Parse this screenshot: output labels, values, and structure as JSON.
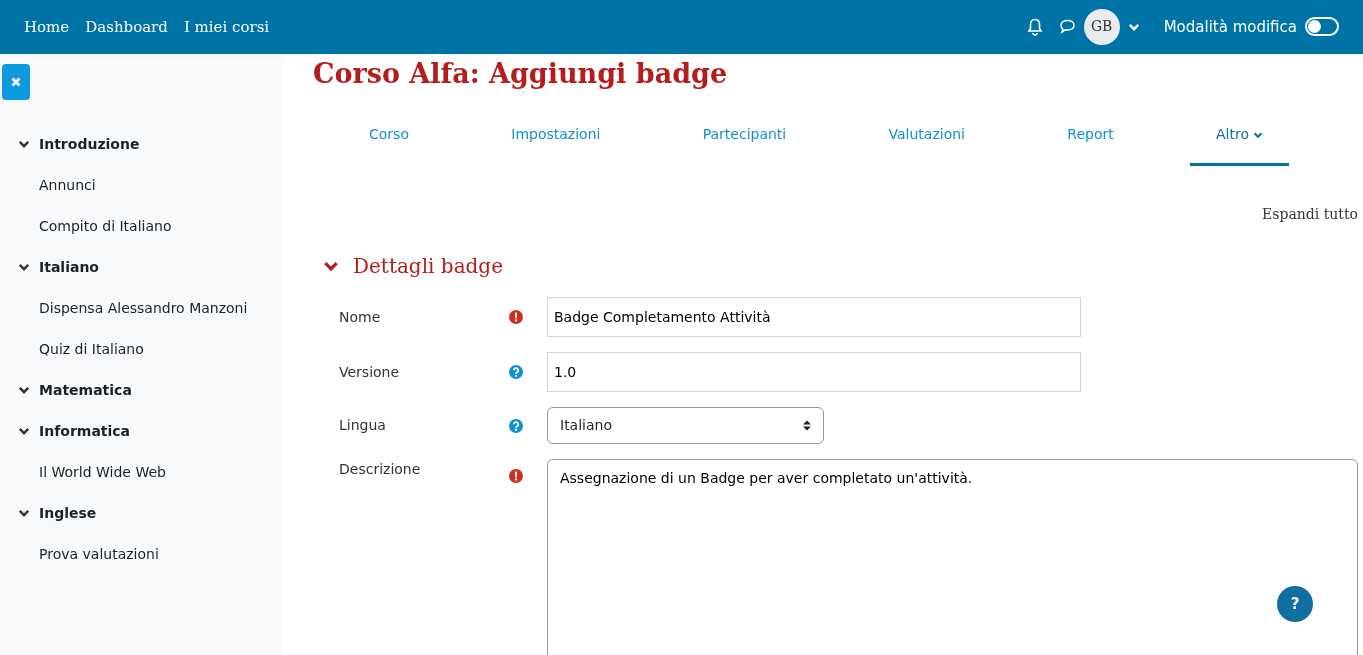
{
  "navbar": {
    "links": [
      "Home",
      "Dashboard",
      "I miei corsi"
    ],
    "avatar": "GB",
    "edit_mode": {
      "label": "Modalità modifica",
      "on": false
    }
  },
  "sidebar": {
    "sections": [
      {
        "title": "Introduzione",
        "expanded": true,
        "children": [
          "Annunci",
          "Compito di Italiano"
        ]
      },
      {
        "title": "Italiano",
        "expanded": true,
        "children": [
          "Dispensa Alessandro Manzoni",
          "Quiz di Italiano"
        ]
      },
      {
        "title": "Matematica",
        "expanded": true
      },
      {
        "title": "Informatica",
        "expanded": true,
        "children": [
          "Il World Wide Web"
        ]
      },
      {
        "title": "Inglese",
        "expanded": true,
        "children": [
          "Prova valutazioni"
        ]
      }
    ]
  },
  "page_title": "Corso Alfa: Aggiungi badge",
  "tabs": [
    {
      "label": "Corso",
      "selected": false,
      "kind": "link"
    },
    {
      "label": "Impostazioni",
      "selected": false,
      "kind": "link"
    },
    {
      "label": "Partecipanti",
      "selected": false,
      "kind": "link"
    },
    {
      "label": "Valutazioni",
      "selected": false,
      "kind": "link"
    },
    {
      "label": "Report",
      "selected": false,
      "kind": "link"
    },
    {
      "label": "Altro",
      "selected": true,
      "kind": "dropdown"
    }
  ],
  "expand_all": "Espandi tutto",
  "section": {
    "title": "Dettagli badge",
    "expanded": true,
    "fields": [
      {
        "label": "Nome",
        "required": true,
        "kind": "text",
        "value": "Badge Completamento Attività"
      },
      {
        "label": "Versione",
        "required": false,
        "kind": "text",
        "value": "1.0"
      },
      {
        "label": "Lingua",
        "required": false,
        "kind": "select",
        "value": "Italiano"
      },
      {
        "label": "Descrizione",
        "required": true,
        "kind": "textarea",
        "value": "Assegnazione di un Badge per aver completato un'attività."
      }
    ]
  },
  "help_button": "?"
}
